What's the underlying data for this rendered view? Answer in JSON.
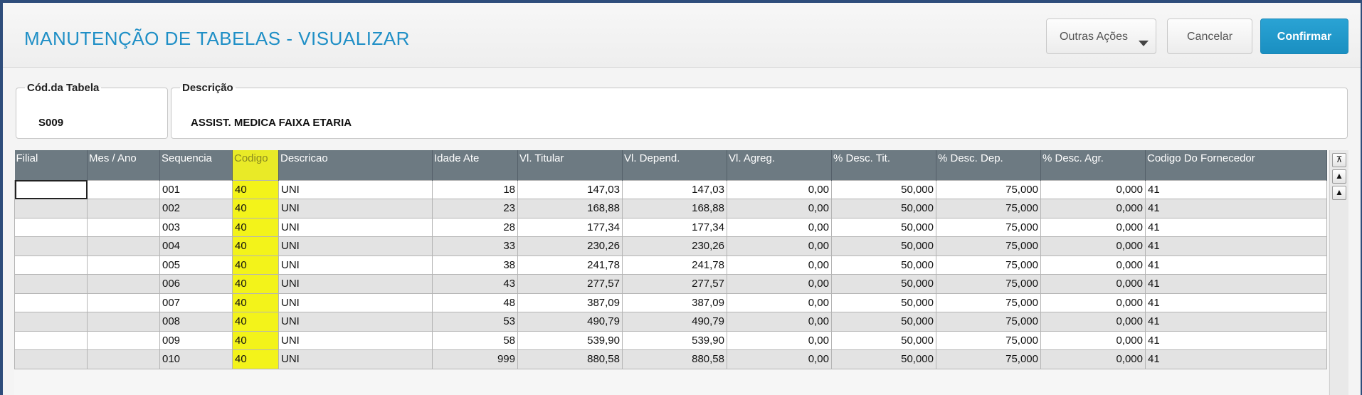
{
  "header": {
    "title": "MANUTENÇÃO DE TABELAS - VISUALIZAR",
    "buttons": {
      "outras": "Outras Ações",
      "cancelar": "Cancelar",
      "confirmar": "Confirmar"
    }
  },
  "fields": {
    "cod_tabela": {
      "label": "Cód.da Tabela",
      "value": "S009"
    },
    "descricao": {
      "label": "Descrição",
      "value": "ASSIST. MEDICA FAIXA ETARIA"
    }
  },
  "grid": {
    "columns": [
      "Filial",
      "Mes / Ano",
      "Sequencia",
      "Codigo",
      "Descricao",
      "Idade Ate",
      "Vl. Titular",
      "Vl. Depend.",
      "Vl. Agreg.",
      "% Desc. Tit.",
      "% Desc. Dep.",
      "% Desc. Agr.",
      "Codigo Do Fornecedor"
    ],
    "rows": [
      [
        "",
        "",
        "001",
        "40",
        "UNI",
        "18",
        "147,03",
        "147,03",
        "0,00",
        "50,000",
        "75,000",
        "0,000",
        "41"
      ],
      [
        "",
        "",
        "002",
        "40",
        "UNI",
        "23",
        "168,88",
        "168,88",
        "0,00",
        "50,000",
        "75,000",
        "0,000",
        "41"
      ],
      [
        "",
        "",
        "003",
        "40",
        "UNI",
        "28",
        "177,34",
        "177,34",
        "0,00",
        "50,000",
        "75,000",
        "0,000",
        "41"
      ],
      [
        "",
        "",
        "004",
        "40",
        "UNI",
        "33",
        "230,26",
        "230,26",
        "0,00",
        "50,000",
        "75,000",
        "0,000",
        "41"
      ],
      [
        "",
        "",
        "005",
        "40",
        "UNI",
        "38",
        "241,78",
        "241,78",
        "0,00",
        "50,000",
        "75,000",
        "0,000",
        "41"
      ],
      [
        "",
        "",
        "006",
        "40",
        "UNI",
        "43",
        "277,57",
        "277,57",
        "0,00",
        "50,000",
        "75,000",
        "0,000",
        "41"
      ],
      [
        "",
        "",
        "007",
        "40",
        "UNI",
        "48",
        "387,09",
        "387,09",
        "0,00",
        "50,000",
        "75,000",
        "0,000",
        "41"
      ],
      [
        "",
        "",
        "008",
        "40",
        "UNI",
        "53",
        "490,79",
        "490,79",
        "0,00",
        "50,000",
        "75,000",
        "0,000",
        "41"
      ],
      [
        "",
        "",
        "009",
        "40",
        "UNI",
        "58",
        "539,90",
        "539,90",
        "0,00",
        "50,000",
        "75,000",
        "0,000",
        "41"
      ],
      [
        "",
        "",
        "010",
        "40",
        "UNI",
        "999",
        "880,58",
        "880,58",
        "0,00",
        "50,000",
        "75,000",
        "0,000",
        "41"
      ]
    ]
  },
  "scrollbar": {
    "icons": [
      "scroll-top-icon",
      "scroll-page-up-icon",
      "scroll-up-icon"
    ]
  },
  "colors": {
    "accent": "#1f8fc6",
    "highlight": "#f3f31a",
    "grid_header": "#6d7a82"
  }
}
